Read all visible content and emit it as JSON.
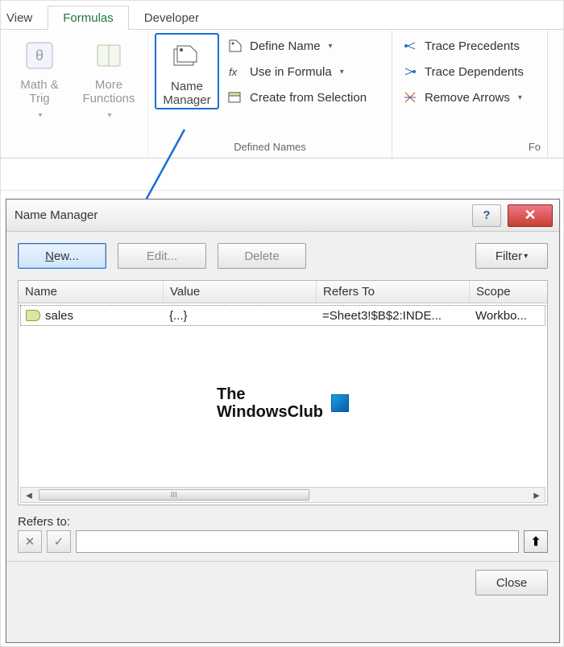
{
  "tabs": {
    "view": "View",
    "formulas": "Formulas",
    "developer": "Developer"
  },
  "ribbon": {
    "math_trig": "Math &\nTrig",
    "more_functions": "More\nFunctions",
    "name_manager": "Name\nManager",
    "define_name": "Define Name",
    "use_in_formula": "Use in Formula",
    "create_from_selection": "Create from Selection",
    "group_defined_names": "Defined Names",
    "trace_precedents": "Trace Precedents",
    "trace_dependents": "Trace Dependents",
    "remove_arrows": "Remove Arrows",
    "group_audit_frag": "Fo"
  },
  "dialog": {
    "title": "Name Manager",
    "new_btn": "New...",
    "edit_btn": "Edit...",
    "delete_btn": "Delete",
    "filter_btn": "Filter",
    "columns": {
      "name": "Name",
      "value": "Value",
      "refers": "Refers To",
      "scope": "Scope"
    },
    "rows": [
      {
        "name": "sales",
        "value": "{...}",
        "refers": "=Sheet3!$B$2:INDE...",
        "scope": "Workbo..."
      }
    ],
    "refers_to_label": "Refers to:",
    "refers_to_value": "",
    "close_btn": "Close"
  },
  "watermark": {
    "line1": "The",
    "line2": "WindowsClub"
  }
}
